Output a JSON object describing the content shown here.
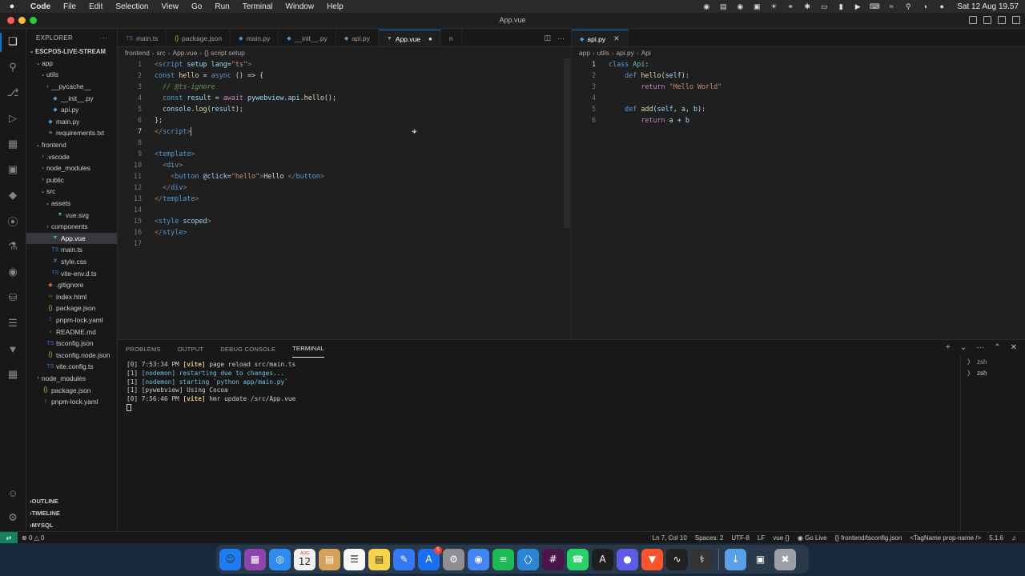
{
  "menubar": {
    "app": "Code",
    "items": [
      "File",
      "Edit",
      "Selection",
      "View",
      "Go",
      "Run",
      "Terminal",
      "Window",
      "Help"
    ],
    "clock": "Sat 12 Aug  19.57"
  },
  "window": {
    "title": "App.vue"
  },
  "explorer": {
    "header": "EXPLORER",
    "root": "ESCPOS-LIVE-STREAM",
    "tree": [
      {
        "label": "app",
        "depth": 0,
        "kind": "folder",
        "open": true
      },
      {
        "label": "utils",
        "depth": 1,
        "kind": "folder",
        "open": true
      },
      {
        "label": "__pycache__",
        "depth": 2,
        "kind": "folder",
        "open": false
      },
      {
        "label": "__init__.py",
        "depth": 2,
        "kind": "py"
      },
      {
        "label": "api.py",
        "depth": 2,
        "kind": "py"
      },
      {
        "label": "main.py",
        "depth": 1,
        "kind": "py"
      },
      {
        "label": "requirements.txt",
        "depth": 1,
        "kind": "txt"
      },
      {
        "label": "frontend",
        "depth": 0,
        "kind": "folder",
        "open": true
      },
      {
        "label": ".vscode",
        "depth": 1,
        "kind": "folder",
        "open": false
      },
      {
        "label": "node_modules",
        "depth": 1,
        "kind": "folder",
        "open": false
      },
      {
        "label": "public",
        "depth": 1,
        "kind": "folder",
        "open": false
      },
      {
        "label": "src",
        "depth": 1,
        "kind": "folder",
        "open": true
      },
      {
        "label": "assets",
        "depth": 2,
        "kind": "folder",
        "open": true
      },
      {
        "label": "vue.svg",
        "depth": 3,
        "kind": "vue"
      },
      {
        "label": "components",
        "depth": 2,
        "kind": "folder",
        "open": false
      },
      {
        "label": "App.vue",
        "depth": 2,
        "kind": "vue",
        "selected": true
      },
      {
        "label": "main.ts",
        "depth": 2,
        "kind": "ts"
      },
      {
        "label": "style.css",
        "depth": 2,
        "kind": "css"
      },
      {
        "label": "vite-env.d.ts",
        "depth": 2,
        "kind": "ts"
      },
      {
        "label": ".gitignore",
        "depth": 1,
        "kind": "git"
      },
      {
        "label": "index.html",
        "depth": 1,
        "kind": "html"
      },
      {
        "label": "package.json",
        "depth": 1,
        "kind": "json"
      },
      {
        "label": "pnpm-lock.yaml",
        "depth": 1,
        "kind": "yaml"
      },
      {
        "label": "README.md",
        "depth": 1,
        "kind": "md"
      },
      {
        "label": "tsconfig.json",
        "depth": 1,
        "kind": "ts"
      },
      {
        "label": "tsconfig.node.json",
        "depth": 1,
        "kind": "json"
      },
      {
        "label": "vite.config.ts",
        "depth": 1,
        "kind": "ts"
      },
      {
        "label": "node_modules",
        "depth": 0,
        "kind": "folder",
        "open": false
      },
      {
        "label": "package.json",
        "depth": 0,
        "kind": "json"
      },
      {
        "label": "pnpm-lock.yaml",
        "depth": 0,
        "kind": "yaml"
      }
    ],
    "sections": [
      "OUTLINE",
      "TIMELINE",
      "MYSQL"
    ]
  },
  "editor1": {
    "tabs": [
      {
        "label": "main.ts",
        "kind": "ts"
      },
      {
        "label": "package.json",
        "kind": "json"
      },
      {
        "label": "main.py",
        "kind": "py"
      },
      {
        "label": "__init__.py",
        "kind": "py"
      },
      {
        "label": "api.py",
        "kind": "py"
      },
      {
        "label": "App.vue",
        "kind": "vue",
        "active": true,
        "dirty": true
      },
      {
        "label": "n",
        "kind": "more"
      }
    ],
    "breadcrumb": [
      "frontend",
      "src",
      "App.vue",
      "{} script setup"
    ],
    "current_line": 7,
    "lines": [
      [
        [
          "tag",
          "<"
        ],
        [
          "tn",
          "script"
        ],
        [
          "pl",
          " "
        ],
        [
          "attr",
          "setup"
        ],
        [
          "pl",
          " "
        ],
        [
          "attr",
          "lang"
        ],
        [
          "pl",
          "="
        ],
        [
          "str",
          "\"ts\""
        ],
        [
          "tag",
          ">"
        ]
      ],
      [
        [
          "kw",
          "const"
        ],
        [
          "pl",
          " "
        ],
        [
          "fn",
          "hello"
        ],
        [
          "pl",
          " = "
        ],
        [
          "kw",
          "async"
        ],
        [
          "pl",
          " () => {"
        ]
      ],
      [
        [
          "pl",
          "  "
        ],
        [
          "cm",
          "// @ts-ignore"
        ]
      ],
      [
        [
          "pl",
          "  "
        ],
        [
          "kw",
          "const"
        ],
        [
          "pl",
          " "
        ],
        [
          "var",
          "result"
        ],
        [
          "pl",
          " = "
        ],
        [
          "kw2",
          "await"
        ],
        [
          "pl",
          " "
        ],
        [
          "var",
          "pywebview"
        ],
        [
          "pl",
          "."
        ],
        [
          "var",
          "api"
        ],
        [
          "pl",
          "."
        ],
        [
          "fn",
          "hello"
        ],
        [
          "pl",
          "();"
        ]
      ],
      [
        [
          "pl",
          "  "
        ],
        [
          "var",
          "console"
        ],
        [
          "pl",
          "."
        ],
        [
          "fn",
          "log"
        ],
        [
          "pl",
          "("
        ],
        [
          "var",
          "result"
        ],
        [
          "pl",
          ");"
        ]
      ],
      [
        [
          "pl",
          "};"
        ]
      ],
      [
        [
          "tag",
          "</"
        ],
        [
          "tn",
          "script"
        ],
        [
          "tag",
          ">"
        ]
      ],
      [],
      [
        [
          "tag",
          "<"
        ],
        [
          "tn",
          "template"
        ],
        [
          "tag",
          ">"
        ]
      ],
      [
        [
          "pl",
          "  "
        ],
        [
          "tag",
          "<"
        ],
        [
          "tn",
          "div"
        ],
        [
          "tag",
          ">"
        ]
      ],
      [
        [
          "pl",
          "    "
        ],
        [
          "tag",
          "<"
        ],
        [
          "tn",
          "button"
        ],
        [
          "pl",
          " "
        ],
        [
          "attr",
          "@click"
        ],
        [
          "pl",
          "="
        ],
        [
          "str",
          "\"hello\""
        ],
        [
          "tag",
          ">"
        ],
        [
          "pl",
          "Hello "
        ],
        [
          "tag",
          "</"
        ],
        [
          "tn",
          "button"
        ],
        [
          "tag",
          ">"
        ]
      ],
      [
        [
          "pl",
          "  "
        ],
        [
          "tag",
          "</"
        ],
        [
          "tn",
          "div"
        ],
        [
          "tag",
          ">"
        ]
      ],
      [
        [
          "tag",
          "</"
        ],
        [
          "tn",
          "template"
        ],
        [
          "tag",
          ">"
        ]
      ],
      [],
      [
        [
          "tag",
          "<"
        ],
        [
          "tn",
          "style"
        ],
        [
          "pl",
          " "
        ],
        [
          "attr",
          "scoped"
        ],
        [
          "tag",
          ">"
        ]
      ],
      [
        [
          "tag",
          "</"
        ],
        [
          "tn",
          "style"
        ],
        [
          "tag",
          ">"
        ]
      ],
      []
    ]
  },
  "editor2": {
    "tabs": [
      {
        "label": "api.py",
        "kind": "py",
        "active": true
      }
    ],
    "breadcrumb": [
      "app",
      "utils",
      "api.py",
      "Api"
    ],
    "current_line": 1,
    "lines": [
      [
        [
          "kw",
          "class"
        ],
        [
          "pl",
          " "
        ],
        [
          "cls",
          "Api"
        ],
        [
          "pl",
          ":"
        ]
      ],
      [
        [
          "pl",
          "    "
        ],
        [
          "kw",
          "def"
        ],
        [
          "pl",
          " "
        ],
        [
          "fn",
          "hello"
        ],
        [
          "pl",
          "("
        ],
        [
          "var",
          "self"
        ],
        [
          "pl",
          "):"
        ]
      ],
      [
        [
          "pl",
          "        "
        ],
        [
          "kw2",
          "return"
        ],
        [
          "pl",
          " "
        ],
        [
          "str",
          "\"Hello World\""
        ]
      ],
      [],
      [
        [
          "pl",
          "    "
        ],
        [
          "kw",
          "def"
        ],
        [
          "pl",
          " "
        ],
        [
          "fn",
          "add"
        ],
        [
          "pl",
          "("
        ],
        [
          "var",
          "self"
        ],
        [
          "pl",
          ", "
        ],
        [
          "var",
          "a"
        ],
        [
          "pl",
          ", "
        ],
        [
          "var",
          "b"
        ],
        [
          "pl",
          "):"
        ]
      ],
      [
        [
          "pl",
          "        "
        ],
        [
          "kw2",
          "return"
        ],
        [
          "pl",
          " "
        ],
        [
          "var",
          "a"
        ],
        [
          "pl",
          " + "
        ],
        [
          "var",
          "b"
        ]
      ]
    ]
  },
  "panel": {
    "tabs": [
      "PROBLEMS",
      "OUTPUT",
      "DEBUG CONSOLE",
      "TERMINAL"
    ],
    "active_tab": "TERMINAL",
    "terminal_lines": [
      [
        [
          "t-pl",
          "[0] "
        ],
        [
          "t-time",
          "7:53:34 PM "
        ],
        [
          "t-vite",
          "[vite]"
        ],
        [
          "t-upd",
          " page reload src/main.ts"
        ]
      ],
      [
        [
          "t-pl",
          "[1] "
        ],
        [
          "t-nodemon",
          "[nodemon] restarting due to changes..."
        ]
      ],
      [
        [
          "t-pl",
          "[1] "
        ],
        [
          "t-nodemon",
          "[nodemon] starting `python app/main.py`"
        ]
      ],
      [
        [
          "t-pl",
          "[1] "
        ],
        [
          "t-upd",
          "[pywebview] Using Cocoa"
        ]
      ],
      [
        [
          "t-pl",
          "[0] "
        ],
        [
          "t-time",
          "7:56:46 PM "
        ],
        [
          "t-vite",
          "[vite]"
        ],
        [
          "t-upd",
          " hmr update /src/App.vue"
        ]
      ]
    ],
    "terminals": [
      "zsh",
      "zsh"
    ]
  },
  "statusbar": {
    "problems": "0",
    "warnings": "0",
    "cursor": "Ln 7, Col 10",
    "spaces": "Spaces: 2",
    "encoding": "UTF-8",
    "eol": "LF",
    "language": "vue",
    "golive": "Go Live",
    "tsconfig": "frontend/tsconfig.json",
    "tagname": "<TagName prop-name />",
    "version": "5.1.6"
  },
  "dock": {
    "calendar_month": "AUG",
    "calendar_day": "12",
    "appstore_badge": "5",
    "colors": [
      "#1c7cf4",
      "#8e44ad",
      "#2d8cf0",
      "#f0f0f0",
      "#d8a15a",
      "#f7f7f7",
      "#f6d34a",
      "#3478f6",
      "#1a6ff0",
      "#8e8e93",
      "#4285f4",
      "#1db954",
      "#2b84d6",
      "#4a154b",
      "#25d366",
      "#1e1e1e",
      "#5e5ce6",
      "#fb542b",
      "#222222",
      "#333333",
      "#5aa0e6",
      "#2b3a4a",
      "#9aa0a6"
    ]
  }
}
